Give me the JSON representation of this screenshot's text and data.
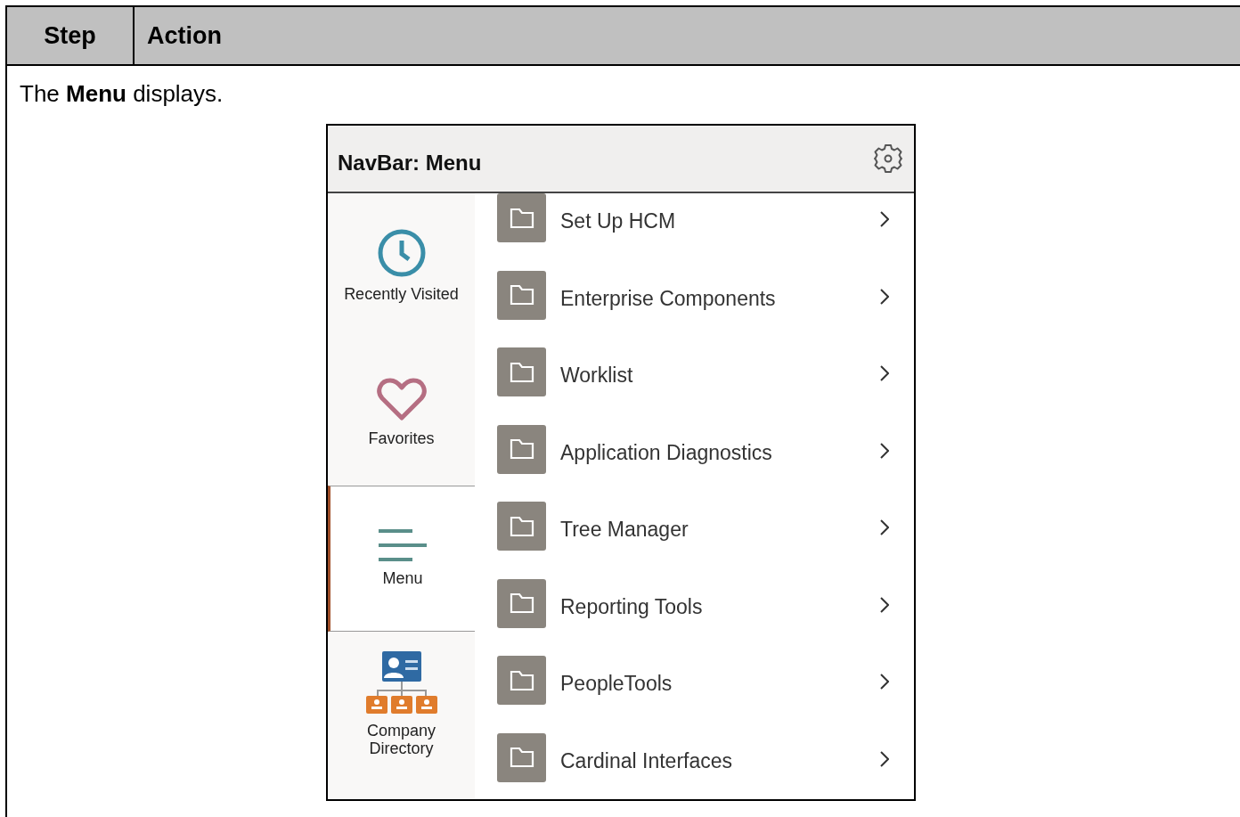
{
  "table": {
    "columns": [
      "Step",
      "Action"
    ],
    "instruction": "The **Menu** displays.",
    "screenshot": {
      "title": "NavBar: Menu",
      "sidebar": [
        {
          "label": "Recently Visited",
          "kind": "clock",
          "selected": false
        },
        {
          "label": "Favorites",
          "kind": "heart",
          "selected": false
        },
        {
          "label": "Menu",
          "kind": "menu",
          "selected": true
        },
        {
          "label": "Company Directory",
          "kind": "directory",
          "selected": false
        }
      ],
      "items": [
        {
          "label": "Set Up HCM"
        },
        {
          "label": "Enterprise Components"
        },
        {
          "label": "Worklist"
        },
        {
          "label": "Application Diagnostics"
        },
        {
          "label": "Tree Manager"
        },
        {
          "label": "Reporting Tools"
        },
        {
          "label": "PeopleTools"
        },
        {
          "label": "Cardinal Interfaces"
        }
      ]
    }
  }
}
